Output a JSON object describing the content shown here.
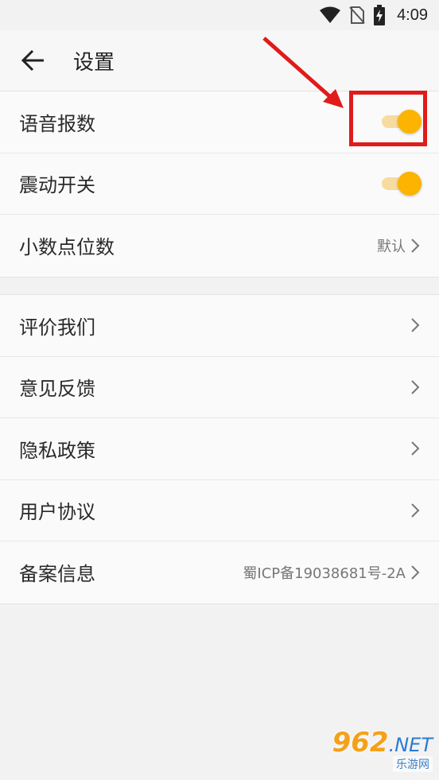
{
  "status_bar": {
    "time": "4:09",
    "icons": [
      "wifi-icon",
      "no-sim-icon",
      "battery-charging-icon"
    ]
  },
  "app_bar": {
    "back_icon": "arrow-left-icon",
    "title": "设置"
  },
  "group1": {
    "items": [
      {
        "label": "语音报数",
        "control": "toggle",
        "on": true
      },
      {
        "label": "震动开关",
        "control": "toggle",
        "on": true
      },
      {
        "label": "小数点位数",
        "value": "默认"
      }
    ]
  },
  "group2": {
    "items": [
      {
        "label": "评价我们"
      },
      {
        "label": "意见反馈"
      },
      {
        "label": "隐私政策"
      },
      {
        "label": "用户协议"
      },
      {
        "label": "备案信息",
        "value": "蜀ICP备19038681号-2A"
      }
    ]
  },
  "colors": {
    "toggle_knob": "#fcb400",
    "toggle_track": "#f8dba0",
    "annotation_red": "#e01b1b"
  },
  "watermark": {
    "brand": "962",
    "suffix": ".NET",
    "subtitle": "乐游网"
  }
}
